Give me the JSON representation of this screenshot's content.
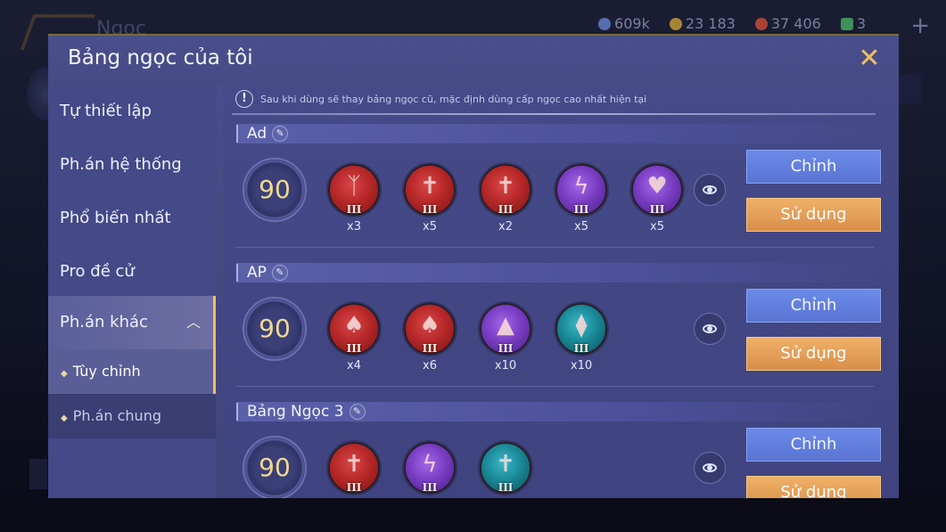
{
  "background": {
    "title": "Ngọc",
    "currency": [
      {
        "icon": "coin-icon",
        "value": "609k",
        "color": "#6a8ad8"
      },
      {
        "icon": "gold-icon",
        "value": "23 183",
        "color": "#d8a838"
      },
      {
        "icon": "ruby-icon",
        "value": "37 406",
        "color": "#d85038"
      },
      {
        "icon": "ticket-icon",
        "value": "3",
        "color": "#4ab868"
      }
    ],
    "plus": "+"
  },
  "modal": {
    "title": "Bảng ngọc của tôi",
    "close": "✕"
  },
  "sidebar": {
    "items": [
      {
        "label": "Tự thiết lập"
      },
      {
        "label": "Ph.án hệ thống"
      },
      {
        "label": "Phổ biến nhất"
      },
      {
        "label": "Pro đề cử"
      },
      {
        "label": "Ph.án khác"
      }
    ],
    "chevron": "︿",
    "sub_items": [
      {
        "label": "Tùy chỉnh"
      },
      {
        "label": "Ph.án chung"
      }
    ]
  },
  "content": {
    "notice_icon": "!",
    "notice": "Sau khi dùng sẽ thay bảng ngọc cũ, mặc định dùng cấp ngọc cao nhất hiện tại",
    "sets": [
      {
        "name": "Ad",
        "level": "90",
        "gems": [
          {
            "color": "red",
            "icon": "claw-icon",
            "glyph": "ᛉ",
            "tier": "III",
            "count": "x3"
          },
          {
            "color": "red",
            "icon": "sword-icon",
            "glyph": "✝",
            "tier": "III",
            "count": "x5"
          },
          {
            "color": "red",
            "icon": "sword-icon",
            "glyph": "✝",
            "tier": "III",
            "count": "x2"
          },
          {
            "color": "purple",
            "icon": "lightning-icon",
            "glyph": "ϟ",
            "tier": "III",
            "count": "x5"
          },
          {
            "color": "purple",
            "icon": "heart-icon",
            "glyph": "♥",
            "tier": "III",
            "count": "x5"
          }
        ],
        "edit_label": "Chỉnh",
        "use_label": "Sử dụng"
      },
      {
        "name": "AP",
        "level": "90",
        "gems": [
          {
            "color": "red",
            "icon": "spade-icon",
            "glyph": "♠",
            "tier": "III",
            "count": "x4"
          },
          {
            "color": "red",
            "icon": "spade-icon",
            "glyph": "♠",
            "tier": "III",
            "count": "x6"
          },
          {
            "color": "purple",
            "icon": "drop-icon",
            "glyph": "▲",
            "tier": "III",
            "count": "x10"
          },
          {
            "color": "teal",
            "icon": "crystal-icon",
            "glyph": "⧫",
            "tier": "III",
            "count": "x10"
          }
        ],
        "edit_label": "Chỉnh",
        "use_label": "Sử dụng"
      },
      {
        "name": "Bảng Ngọc 3",
        "level": "90",
        "gems": [
          {
            "color": "red",
            "icon": "sword-icon",
            "glyph": "✝",
            "tier": "III",
            "count": ""
          },
          {
            "color": "purple",
            "icon": "lightning-icon",
            "glyph": "ϟ",
            "tier": "III",
            "count": ""
          },
          {
            "color": "teal",
            "icon": "sword-icon",
            "glyph": "✝",
            "tier": "III",
            "count": ""
          }
        ],
        "edit_label": "Chỉnh",
        "use_label": "Sử dụng"
      }
    ]
  },
  "colors": {
    "accent": "#f0c060",
    "edit_button": "#6b8be8",
    "use_button": "#e8a058",
    "panel": "#454a88"
  }
}
